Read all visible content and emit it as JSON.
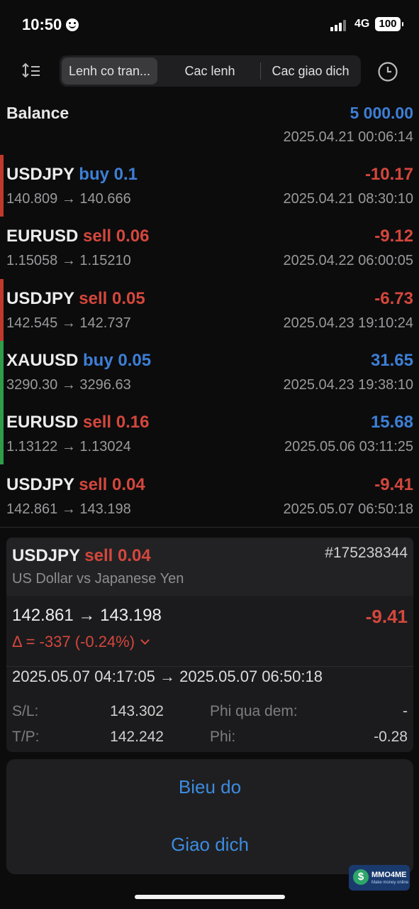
{
  "status_bar": {
    "time": "10:50",
    "network": "4G",
    "battery": "100"
  },
  "toolbar": {
    "tabs": [
      {
        "label": "Lenh co tran..."
      },
      {
        "label": "Cac lenh"
      },
      {
        "label": "Cac giao dich"
      }
    ],
    "active_tab": 0
  },
  "balance": {
    "label": "Balance",
    "value": "5 000.00",
    "date": "2025.04.21 00:06:14"
  },
  "trades": [
    {
      "symbol": "USDJPY",
      "side": "buy",
      "volume": "0.1",
      "side_text": "buy 0.1",
      "prices": "140.809 → 140.666",
      "profit": "-10.17",
      "date": "2025.04.21 08:30:10",
      "marker": "#c0392b"
    },
    {
      "symbol": "EURUSD",
      "side": "sell",
      "volume": "0.06",
      "side_text": "sell 0.06",
      "prices": "1.15058 → 1.15210",
      "profit": "-9.12",
      "date": "2025.04.22 06:00:05",
      "marker": ""
    },
    {
      "symbol": "USDJPY",
      "side": "sell",
      "volume": "0.05",
      "side_text": "sell 0.05",
      "prices": "142.545 → 142.737",
      "profit": "-6.73",
      "date": "2025.04.23 19:10:24",
      "marker": "#c0392b"
    },
    {
      "symbol": "XAUUSD",
      "side": "buy",
      "volume": "0.05",
      "side_text": "buy 0.05",
      "prices": "3290.30 → 3296.63",
      "profit": "31.65",
      "date": "2025.04.23 19:38:10",
      "marker": "#2e9d4a"
    },
    {
      "symbol": "EURUSD",
      "side": "sell",
      "volume": "0.16",
      "side_text": "sell 0.16",
      "prices": "1.13122 → 1.13024",
      "profit": "15.68",
      "date": "2025.05.06 03:11:25",
      "marker": "#2e9d4a"
    },
    {
      "symbol": "USDJPY",
      "side": "sell",
      "volume": "0.04",
      "side_text": "sell 0.04",
      "prices": "142.861 → 143.198",
      "profit": "-9.41",
      "date": "2025.05.07 06:50:18",
      "marker": ""
    }
  ],
  "detail": {
    "symbol": "USDJPY",
    "side_text": "sell 0.04",
    "ticket": "#175238344",
    "description": "US Dollar vs Japanese Yen",
    "prices": "142.861 → 143.198",
    "profit": "-9.41",
    "delta": "Δ = -337 (-0.24%)",
    "dates": "2025.05.07 04:17:05 → 2025.05.07 06:50:18",
    "sl_label": "S/L:",
    "sl_value": "143.302",
    "tp_label": "T/P:",
    "tp_value": "142.242",
    "swap_label": "Phi qua dem:",
    "swap_value": "-",
    "fee_label": "Phi:",
    "fee_value": "-0.28"
  },
  "actions": {
    "chart": "Bieu do",
    "trade": "Giao dich"
  },
  "watermark": {
    "name": "MMO4ME",
    "tagline": "Make money online",
    "coin": "$"
  },
  "colors": {
    "accent_blue": "#3d7fd6",
    "loss_red": "#d4473c",
    "profit_green": "#2e9d4a",
    "background": "#0c0c0d"
  }
}
